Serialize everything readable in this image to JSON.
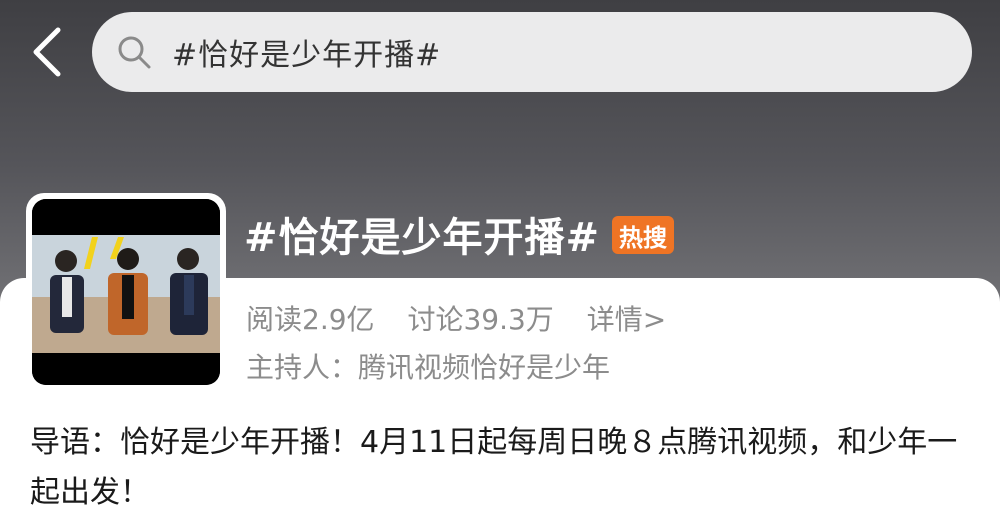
{
  "search": {
    "query": "#恰好是少年开播#"
  },
  "topic": {
    "title": "#恰好是少年开播#",
    "badge": "热搜",
    "reads": "阅读2.9亿",
    "discussions": "讨论39.3万",
    "detail_link": "详情>",
    "host_label": "主持人：",
    "host_name": "腾讯视频恰好是少年"
  },
  "intro": {
    "label": "导语：",
    "text": "恰好是少年开播！4月11日起每周日晚８点腾讯视频，和少年一起出发！"
  },
  "icons": {
    "back": "chevron-left-icon",
    "search": "search-icon"
  },
  "colors": {
    "badge": "#ef7424",
    "search_bg": "#ebebec"
  }
}
